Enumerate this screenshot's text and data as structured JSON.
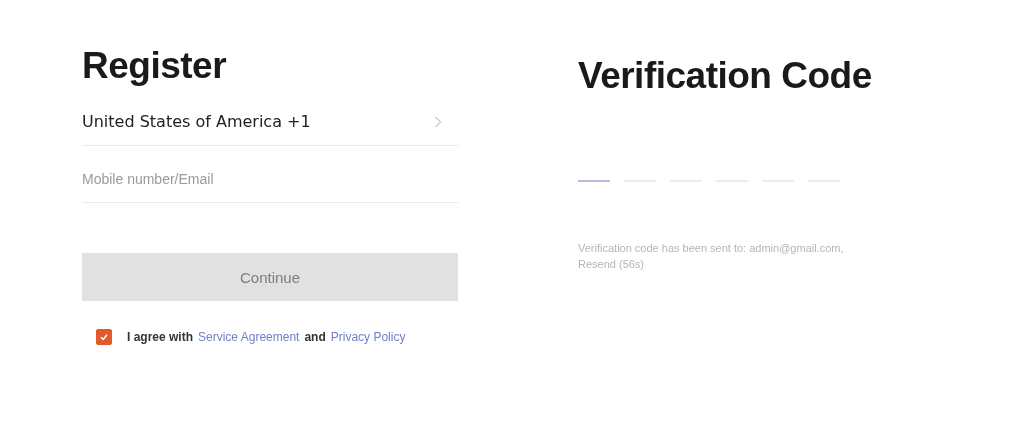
{
  "register": {
    "title": "Register",
    "country": {
      "value": "United States of America +1"
    },
    "account_field": {
      "placeholder": "Mobile number/Email"
    },
    "continue_button": {
      "label": "Continue",
      "disabled": true
    },
    "agreement": {
      "checked": true,
      "text": "I agree with",
      "link_1": "Service Agreement",
      "joiner": "and",
      "link_2": "Privacy Policy"
    }
  },
  "verification": {
    "title": "Verification Code",
    "code_slots": [
      {
        "selected": true
      },
      {
        "selected": false
      },
      {
        "selected": false
      },
      {
        "selected": false
      },
      {
        "selected": false
      },
      {
        "selected": false
      }
    ],
    "message": "Verification code has been sent to: admin@gmail.com,",
    "resend": "Resend (56s)"
  }
}
